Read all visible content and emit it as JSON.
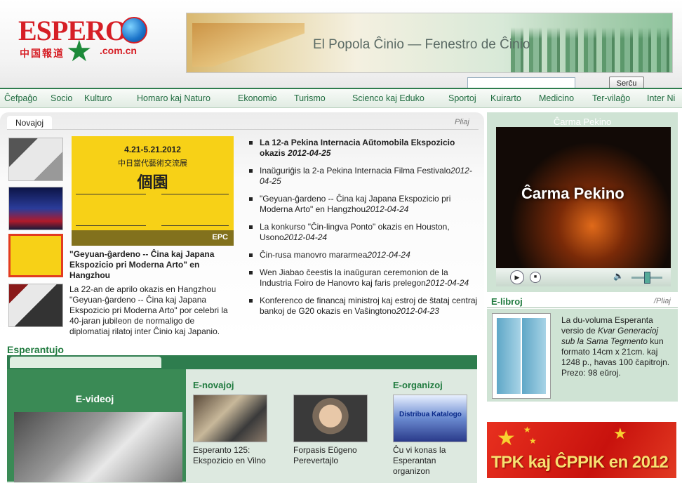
{
  "header": {
    "logo_main": "ESPERO",
    "logo_sub": "中国報道",
    "logo_domain": ".com.cn",
    "banner_text": "El Popola Ĉinio — Fenestro de Ĉinio",
    "search_button": "Serĉu"
  },
  "nav": {
    "items": [
      "Ĉefpaĝo",
      "Socio",
      "Kulturo",
      "Homaro kaj Naturo",
      "Ekonomio",
      "Turismo",
      "Scienco kaj Eduko",
      "Sportoj",
      "Kuirarto",
      "Medicino",
      "Ter-vilaĝo",
      "Inter Ni"
    ]
  },
  "novajoj": {
    "tab_label": "Novajoj",
    "more_label": "Pliaj",
    "featured_image_text": {
      "line1": "4.21-5.21.2012",
      "line2": "中日當代藝術交流展",
      "line3": "個園",
      "footer": "EPC"
    },
    "featured_title": "\"Geyuan-ĝardeno -- Ĉina kaj Japana Ekspozicio pri Moderna Arto\" en Hangzhou",
    "featured_desc": "La 22-an de aprilo okazis en Hangzhou \"Geyuan-ĝardeno -- Ĉina kaj Japana Ekspozicio pri Moderna Arto\" por celebri la 40-jaran jubileon de normaligo de diplomatiaj rilatoj inter Ĉinio kaj Japanio.",
    "news": [
      {
        "title": "La 12-a Pekina Internacia Aŭtomobila Ekspozicio okazis ",
        "date": "2012-04-25"
      },
      {
        "title": "Inaŭguriĝis la 2-a Pekina Internacia Filma Festivalo",
        "date": "2012-04-25"
      },
      {
        "title": "\"Geyuan-ĝardeno -- Ĉina kaj Japana Ekspozicio pri Moderna Arto\" en Hangzhou",
        "date": "2012-04-24"
      },
      {
        "title": "La konkurso \"Ĉin-lingva Ponto\" okazis en Houston, Usono",
        "date": "2012-04-24"
      },
      {
        "title": "Ĉin-rusa manovro mararmea",
        "date": "2012-04-24"
      },
      {
        "title": "Wen Jiabao ĉeestis la inaŭguran ceremonion de la Industria Foiro de Hanovro kaj faris prelegon",
        "date": "2012-04-24"
      },
      {
        "title": "Konferenco de financaj ministroj kaj estroj de ŝtataj centraj bankoj de G20 okazis en Vaŝingtono",
        "date": "2012-04-23"
      }
    ]
  },
  "esperantujo": {
    "title": "Esperantujo",
    "evideoj_title": "E-videoj",
    "enovajoj_title": "E-novajoj",
    "eorganizoj_title": "E-organizoj",
    "cards": [
      {
        "caption": "Esperanto 125: Ekspozicio en Vilno"
      },
      {
        "caption": "Forpasis Eŭgeno Perevertajlo"
      },
      {
        "caption": "Ĉu vi konas la Esperantan organizon"
      }
    ],
    "organizoj_image_text": "Distribua Katalogo"
  },
  "right": {
    "video_title": "Ĉarma Pekino",
    "video_overlay": "Ĉarma Pekino",
    "elibroj_title": "E-libroj",
    "elibroj_more": "/Pliaj",
    "book_desc_pre": "La du-voluma Esperanta versio de ",
    "book_desc_italic": "Kvar Generacioj sub la Sama Tegmento",
    "book_desc_post": " kun formato 14cm x 21cm. kaj 1248 p., havas 100 ĉapitrojn. Prezo: 98 eŭroj.",
    "tpk_text": "TPK kaj ĈPPIK en 2012"
  },
  "image_marks": {
    "epc": "EPC"
  }
}
